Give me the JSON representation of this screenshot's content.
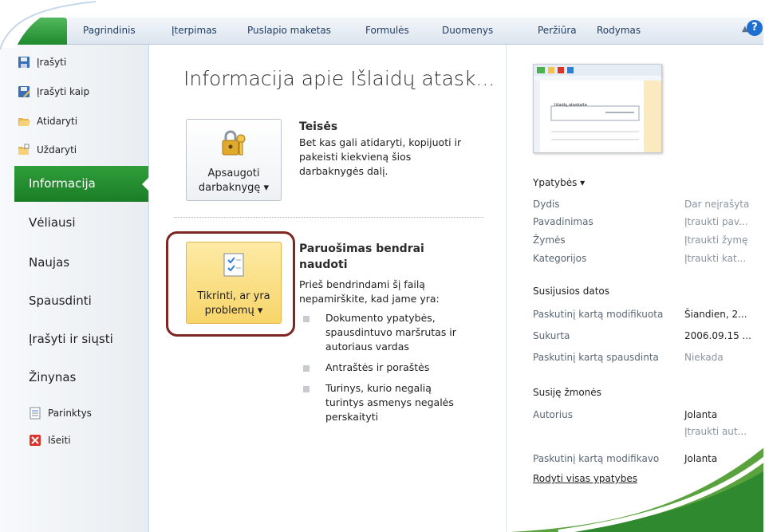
{
  "ribbon": {
    "tabs": [
      "Pagrindinis",
      "Įterpimas",
      "Puslapio maketas",
      "Formulės",
      "Duomenys",
      "Peržiūra",
      "Rodymas"
    ]
  },
  "nav": {
    "small_items": [
      {
        "label": "Įrašyti",
        "icon": "save-icon"
      },
      {
        "label": "Įrašyti kaip",
        "icon": "save-as-icon"
      },
      {
        "label": "Atidaryti",
        "icon": "open-folder-icon"
      },
      {
        "label": "Uždaryti",
        "icon": "close-folder-icon"
      }
    ],
    "selected": "Informacija",
    "big_items": [
      "Vėliausi",
      "Naujas",
      "Spausdinti",
      "Įrašyti ir siųsti",
      "Žinynas"
    ],
    "bottom_items": [
      {
        "label": "Parinktys",
        "icon": "options-icon"
      },
      {
        "label": "Išeiti",
        "icon": "exit-icon"
      }
    ]
  },
  "main": {
    "title": "Informacija apie Išlaidų atask...",
    "permissions": {
      "button_line1": "Apsaugoti",
      "button_line2": "darbaknygę ▾",
      "heading": "Teisės",
      "text_line1": "Bet kas gali atidaryti, kopijuoti ir",
      "text_line2": "pakeisti kiekvieną šios",
      "text_line3": "darbaknygės dalį."
    },
    "prepare": {
      "button_line1": "Tikrinti, ar yra",
      "button_line2": "problemų ▾",
      "heading_line1": "Paruošimas bendrai",
      "heading_line2": "naudoti",
      "text_line1": "Prieš bendrindami šį failą",
      "text_line2": "nepamirškite, kad jame yra:",
      "bullets": [
        [
          "Dokumento ypatybės,",
          "spausdintuvo maršrutas ir",
          "autoriaus vardas"
        ],
        [
          "Antraštės ir poraštės"
        ],
        [
          "Turinys, kurio negalią",
          "turintys asmenys negalės",
          "perskaityti"
        ]
      ]
    }
  },
  "right": {
    "props_heading": "Ypatybės ▾",
    "props": [
      {
        "key": "Dydis",
        "value": "Dar neįrašyta",
        "muted": true
      },
      {
        "key": "Pavadinimas",
        "value": "Įtraukti pav...",
        "muted": true
      },
      {
        "key": "Žymės",
        "value": "Įtraukti žymę",
        "muted": true
      },
      {
        "key": "Kategorijos",
        "value": "Įtraukti kat...",
        "muted": true
      }
    ],
    "dates_heading": "Susijusios datos",
    "dates": [
      {
        "key": "Paskutinį kartą modifikuota",
        "value": "Šiandien, 2..."
      },
      {
        "key": "Sukurta",
        "value": "2006.09.15 ..."
      },
      {
        "key": "Paskutinį kartą spausdinta",
        "value": "Niekada"
      }
    ],
    "people_heading": "Susiję žmonės",
    "author_key": "Autorius",
    "author_value": "Jolanta",
    "author_add": "Įtraukti aut...",
    "modified_by_key": "Paskutinį kartą modifikavo",
    "modified_by_value": "Jolanta",
    "show_all_link": "Rodyti visas ypatybes",
    "thumbnail_title": "Išlaidų ataskaita"
  }
}
